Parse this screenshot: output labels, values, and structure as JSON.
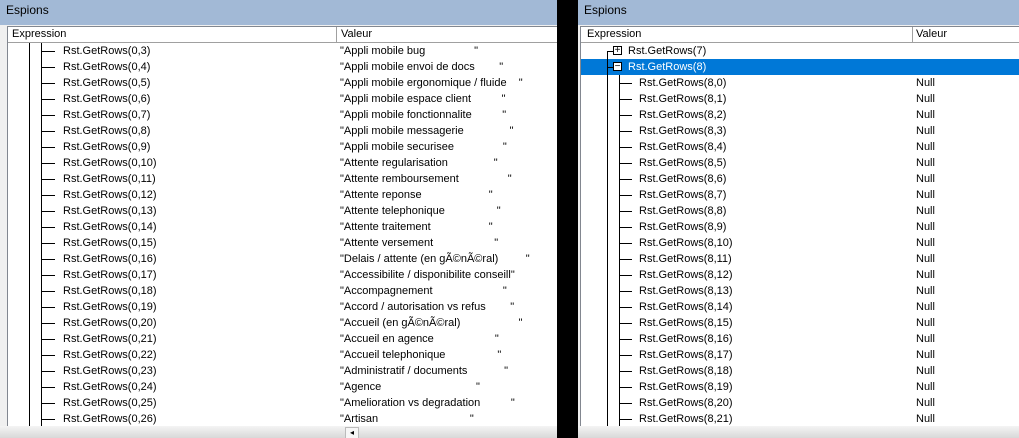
{
  "left": {
    "title": "Espions",
    "col_expression": "Expression",
    "col_value": "Valeur",
    "rows": [
      {
        "e": "Rst.GetRows(0,3)",
        "v": "\"Appli mobile bug                \""
      },
      {
        "e": "Rst.GetRows(0,4)",
        "v": "\"Appli mobile envoi de docs        \""
      },
      {
        "e": "Rst.GetRows(0,5)",
        "v": "\"Appli mobile ergonomique / fluide    \""
      },
      {
        "e": "Rst.GetRows(0,6)",
        "v": "\"Appli mobile espace client          \""
      },
      {
        "e": "Rst.GetRows(0,7)",
        "v": "\"Appli mobile fonctionnalite          \""
      },
      {
        "e": "Rst.GetRows(0,8)",
        "v": "\"Appli mobile messagerie               \""
      },
      {
        "e": "Rst.GetRows(0,9)",
        "v": "\"Appli mobile securisee                \""
      },
      {
        "e": "Rst.GetRows(0,10)",
        "v": "\"Attente regularisation               \""
      },
      {
        "e": "Rst.GetRows(0,11)",
        "v": "\"Attente remboursement                \""
      },
      {
        "e": "Rst.GetRows(0,12)",
        "v": "\"Attente reponse                      \""
      },
      {
        "e": "Rst.GetRows(0,13)",
        "v": "\"Attente telephonique                 \""
      },
      {
        "e": "Rst.GetRows(0,14)",
        "v": "\"Attente traitement                   \""
      },
      {
        "e": "Rst.GetRows(0,15)",
        "v": "\"Attente versement                    \""
      },
      {
        "e": "Rst.GetRows(0,16)",
        "v": "\"Delais / attente (en gÃ©nÃ©ral)         \""
      },
      {
        "e": "Rst.GetRows(0,17)",
        "v": "\"Accessibilite / disponibilite conseill\""
      },
      {
        "e": "Rst.GetRows(0,18)",
        "v": "\"Accompagnement                       \""
      },
      {
        "e": "Rst.GetRows(0,19)",
        "v": "\"Accord / autorisation vs refus        \""
      },
      {
        "e": "Rst.GetRows(0,20)",
        "v": "\"Accueil (en gÃ©nÃ©ral)                   \""
      },
      {
        "e": "Rst.GetRows(0,21)",
        "v": "\"Accueil en agence                    \""
      },
      {
        "e": "Rst.GetRows(0,22)",
        "v": "\"Accueil telephonique                 \""
      },
      {
        "e": "Rst.GetRows(0,23)",
        "v": "\"Administratif / documents            \""
      },
      {
        "e": "Rst.GetRows(0,24)",
        "v": "\"Agence                               \""
      },
      {
        "e": "Rst.GetRows(0,25)",
        "v": "\"Amelioration vs degradation          \""
      },
      {
        "e": "Rst.GetRows(0,26)",
        "v": "\"Artisan                              \""
      }
    ]
  },
  "right": {
    "title": "Espions",
    "col_expression": "Expression",
    "col_value": "Valeur",
    "collapsed_node": "Rst.GetRows(7)",
    "expanded_node": "Rst.GetRows(8)",
    "rows": [
      {
        "e": "Rst.GetRows(8,0)",
        "v": "Null"
      },
      {
        "e": "Rst.GetRows(8,1)",
        "v": "Null"
      },
      {
        "e": "Rst.GetRows(8,2)",
        "v": "Null"
      },
      {
        "e": "Rst.GetRows(8,3)",
        "v": "Null"
      },
      {
        "e": "Rst.GetRows(8,4)",
        "v": "Null"
      },
      {
        "e": "Rst.GetRows(8,5)",
        "v": "Null"
      },
      {
        "e": "Rst.GetRows(8,6)",
        "v": "Null"
      },
      {
        "e": "Rst.GetRows(8,7)",
        "v": "Null"
      },
      {
        "e": "Rst.GetRows(8,8)",
        "v": "Null"
      },
      {
        "e": "Rst.GetRows(8,9)",
        "v": "Null"
      },
      {
        "e": "Rst.GetRows(8,10)",
        "v": "Null"
      },
      {
        "e": "Rst.GetRows(8,11)",
        "v": "Null"
      },
      {
        "e": "Rst.GetRows(8,12)",
        "v": "Null"
      },
      {
        "e": "Rst.GetRows(8,13)",
        "v": "Null"
      },
      {
        "e": "Rst.GetRows(8,14)",
        "v": "Null"
      },
      {
        "e": "Rst.GetRows(8,15)",
        "v": "Null"
      },
      {
        "e": "Rst.GetRows(8,16)",
        "v": "Null"
      },
      {
        "e": "Rst.GetRows(8,17)",
        "v": "Null"
      },
      {
        "e": "Rst.GetRows(8,18)",
        "v": "Null"
      },
      {
        "e": "Rst.GetRows(8,19)",
        "v": "Null"
      },
      {
        "e": "Rst.GetRows(8,20)",
        "v": "Null"
      },
      {
        "e": "Rst.GetRows(8,21)",
        "v": "Null"
      }
    ]
  },
  "colors": {
    "title_bar": "#a2b9d6",
    "selection": "#0078d7"
  },
  "icons": {
    "expand": "plus-box-icon",
    "collapse": "minus-box-icon",
    "scroll_left": "arrow-left-icon"
  }
}
